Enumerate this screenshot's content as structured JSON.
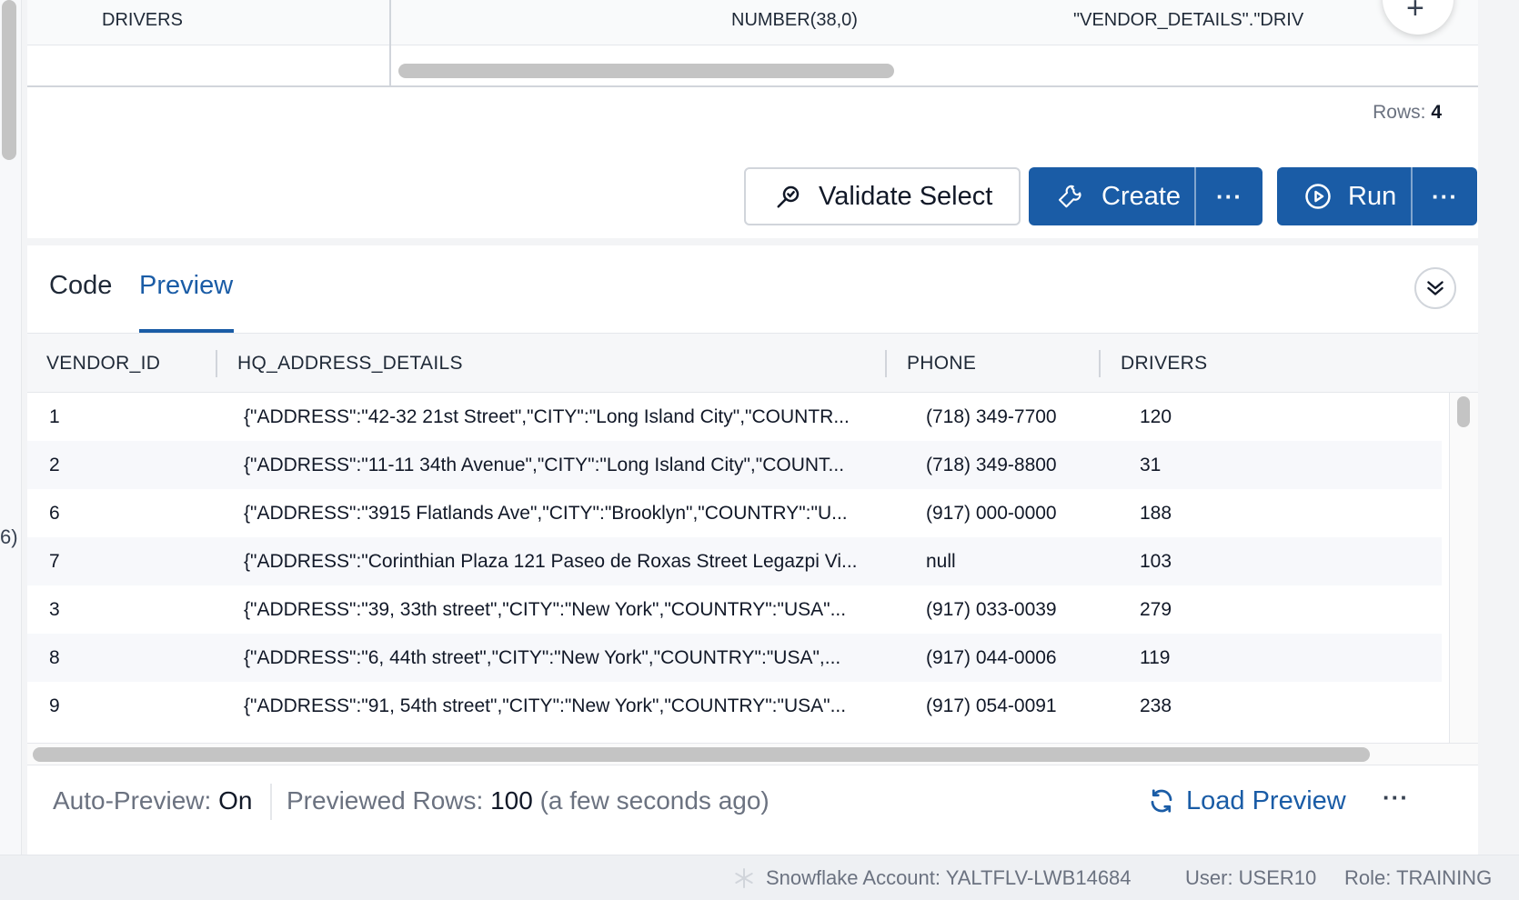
{
  "top_columns": {
    "name": "DRIVERS",
    "type": "NUMBER(38,0)",
    "expression": "\"VENDOR_DETAILS\".\"DRIV"
  },
  "fab_icon": "plus-icon",
  "rows_label": "Rows:",
  "rows_value": "4",
  "actions": {
    "validate_label": "Validate Select",
    "create_label": "Create",
    "run_label": "Run",
    "more_label": "···"
  },
  "tabs": [
    {
      "label": "Code",
      "active": false
    },
    {
      "label": "Preview",
      "active": true
    }
  ],
  "grid": {
    "columns": [
      "VENDOR_ID",
      "HQ_ADDRESS_DETAILS",
      "PHONE",
      "DRIVERS"
    ],
    "rows": [
      [
        "1",
        "{\"ADDRESS\":\"42-32 21st Street\",\"CITY\":\"Long Island City\",\"COUNTR...",
        "(718) 349-7700",
        "120"
      ],
      [
        "2",
        "{\"ADDRESS\":\"11-11 34th Avenue\",\"CITY\":\"Long Island City\",\"COUNT...",
        "(718) 349-8800",
        "31"
      ],
      [
        "6",
        "{\"ADDRESS\":\"3915 Flatlands Ave\",\"CITY\":\"Brooklyn\",\"COUNTRY\":\"U...",
        "(917) 000-0000",
        "188"
      ],
      [
        "7",
        "{\"ADDRESS\":\"Corinthian Plaza 121 Paseo de Roxas Street Legazpi Vi...",
        "null",
        "103"
      ],
      [
        "3",
        "{\"ADDRESS\":\"39, 33th street\",\"CITY\":\"New York\",\"COUNTRY\":\"USA\"...",
        "(917) 033-0039",
        "279"
      ],
      [
        "8",
        "{\"ADDRESS\":\"6, 44th street\",\"CITY\":\"New York\",\"COUNTRY\":\"USA\",...",
        "(917) 044-0006",
        "119"
      ],
      [
        "9",
        "{\"ADDRESS\":\"91, 54th street\",\"CITY\":\"New York\",\"COUNTRY\":\"USA\"...",
        "(917) 054-0091",
        "238"
      ]
    ]
  },
  "footer": {
    "auto_preview_label": "Auto-Preview:",
    "auto_preview_value": "On",
    "previewed_label": "Previewed Rows:",
    "previewed_value": "100",
    "previewed_time": "(a few seconds ago)",
    "load_preview_label": "Load Preview",
    "more_label": "···"
  },
  "status": {
    "account": "Snowflake Account: YALTFLV-LWB14684",
    "user": "User: USER10",
    "role": "Role: TRAINING"
  },
  "left_fragment": "6)",
  "colors": {
    "accent": "#1a5ca6",
    "text": "#1f2937",
    "muted": "#6b7280",
    "border": "#d1d5db"
  }
}
